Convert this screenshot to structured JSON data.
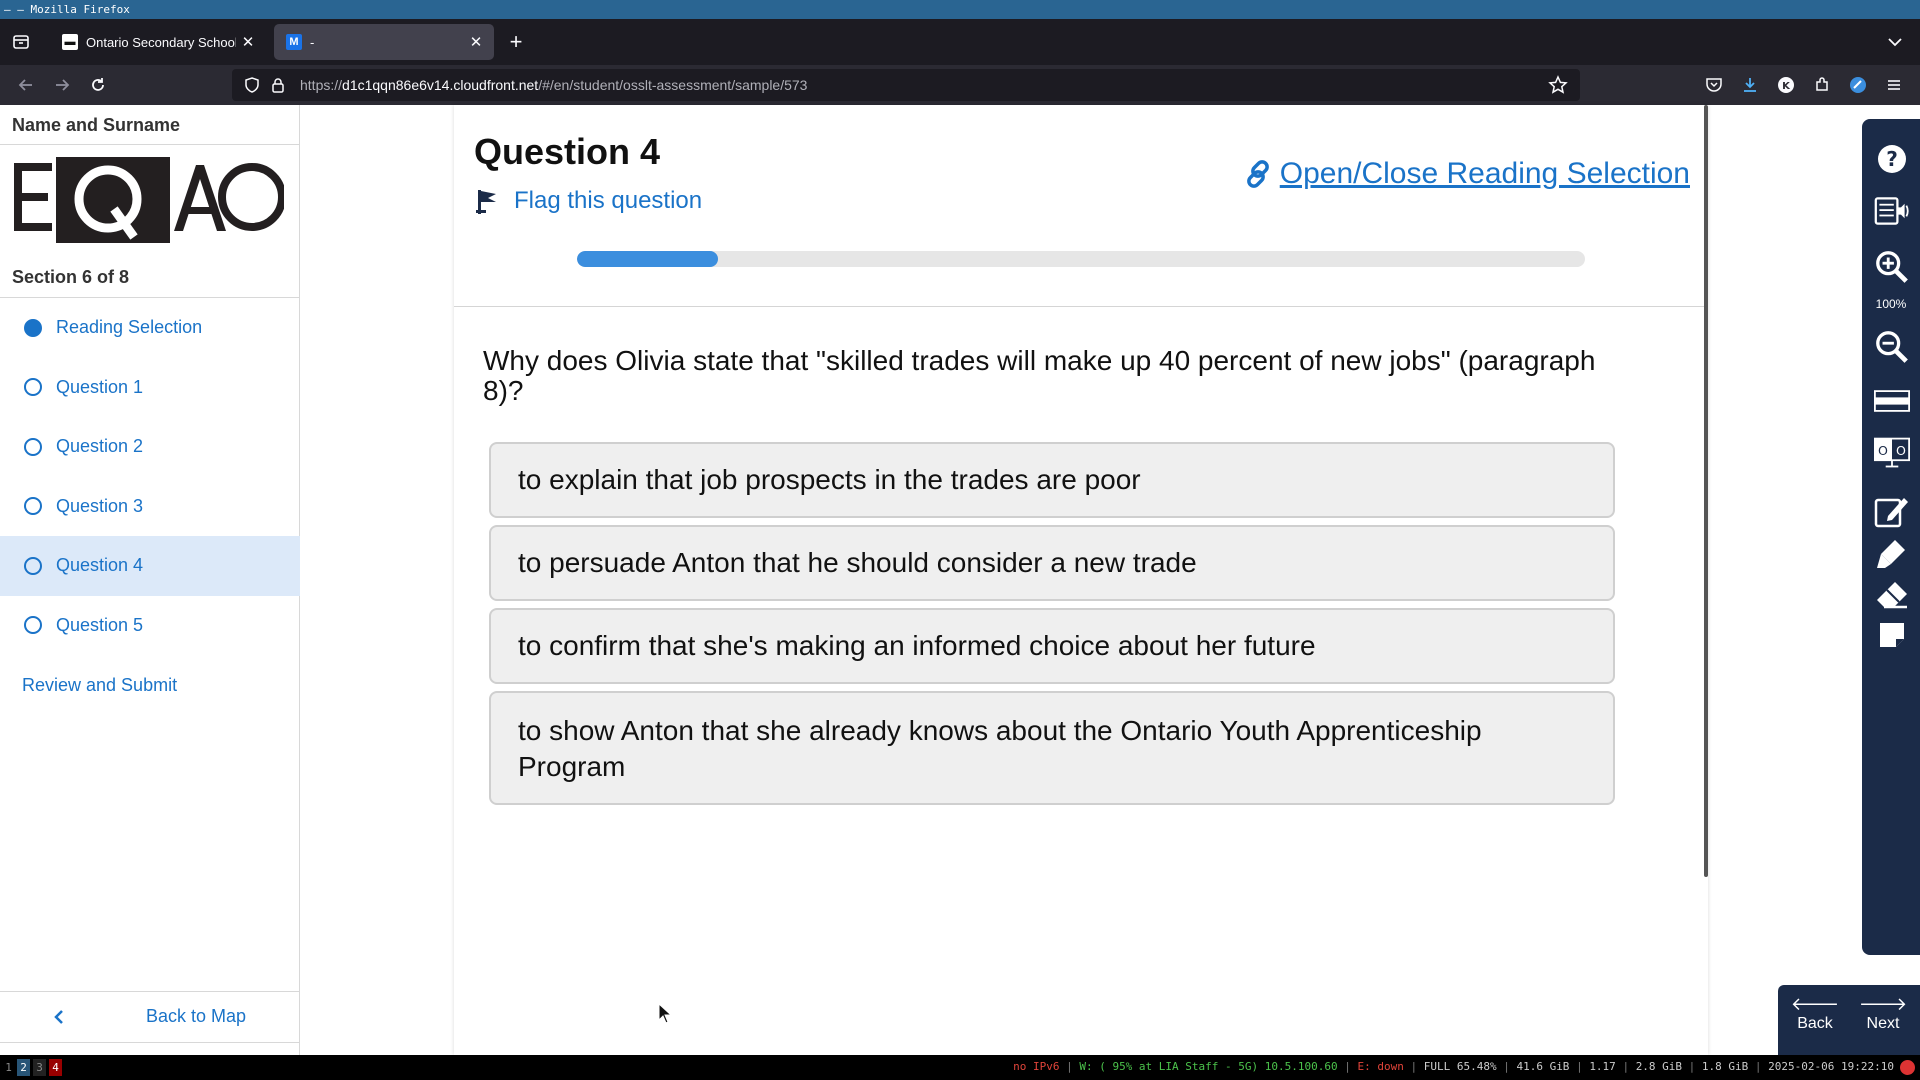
{
  "window": {
    "title": "– — Mozilla Firefox"
  },
  "browser": {
    "tabs": [
      {
        "title": "Ontario Secondary School",
        "favicon": "ossl-favicon",
        "active": false
      },
      {
        "title": "-",
        "favicon": "m-favicon",
        "active": true
      }
    ],
    "url_prefix": "https://",
    "url_host": "d1c1qqn86e6v14.cloudfront.net",
    "url_path": "/#/en/student/osslt-assessment/sample/573"
  },
  "sidebar": {
    "student_label": "Name and Surname",
    "logo_text": "EQAO",
    "section_label": "Section 6 of 8",
    "items": [
      {
        "label": "Reading Selection",
        "state": "filled"
      },
      {
        "label": "Question 1",
        "state": "empty"
      },
      {
        "label": "Question 2",
        "state": "empty"
      },
      {
        "label": "Question 3",
        "state": "empty"
      },
      {
        "label": "Question 4",
        "state": "empty",
        "current": true
      },
      {
        "label": "Question 5",
        "state": "empty"
      }
    ],
    "review_label": "Review and Submit",
    "back_label": "Back to Map"
  },
  "question": {
    "title": "Question 4",
    "flag_label": "Flag this question",
    "reading_toggle_label": "Open/Close Reading Selection",
    "progress_fraction": 0.14,
    "prompt": "Why does Olivia state that \"skilled trades will make up 40 percent of new jobs\" (paragraph 8)?",
    "options": [
      "to explain that job prospects in the trades are poor",
      "to persuade Anton that he should consider a new trade",
      "to confirm that she's making an informed choice about her future",
      "to show Anton that she already knows about the Ontario Youth Apprenticeship Program"
    ]
  },
  "tools": {
    "zoom_level": "100%",
    "items": [
      "help-icon",
      "text-to-speech-icon",
      "zoom-in-icon",
      "zoom-out-icon",
      "line-reader-icon",
      "colour-contrast-icon",
      "notepad-icon",
      "highlighter-icon",
      "eraser-icon",
      "sticky-note-icon"
    ]
  },
  "footer_nav": {
    "back_label": "Back",
    "next_label": "Next"
  },
  "statusbar": {
    "workspaces": [
      "1",
      "2",
      "3",
      "4"
    ],
    "ipv6": "no IPv6",
    "wifi": "W: ( 95% at LIA Staff - 5G) 10.5.100.60",
    "ethernet": "E: down",
    "battery": "FULL 65.48%",
    "disk": "41.6 GiB",
    "load": "1.17",
    "mem_used": "2.8 GiB",
    "mem_avail": "1.8 GiB",
    "datetime": "2025-02-06 19:22:10"
  },
  "colors": {
    "accent": "#1a73c8",
    "toolbar_navy": "#1b2b48",
    "progress": "#3b8ede",
    "selected_row": "#dce9f9"
  }
}
